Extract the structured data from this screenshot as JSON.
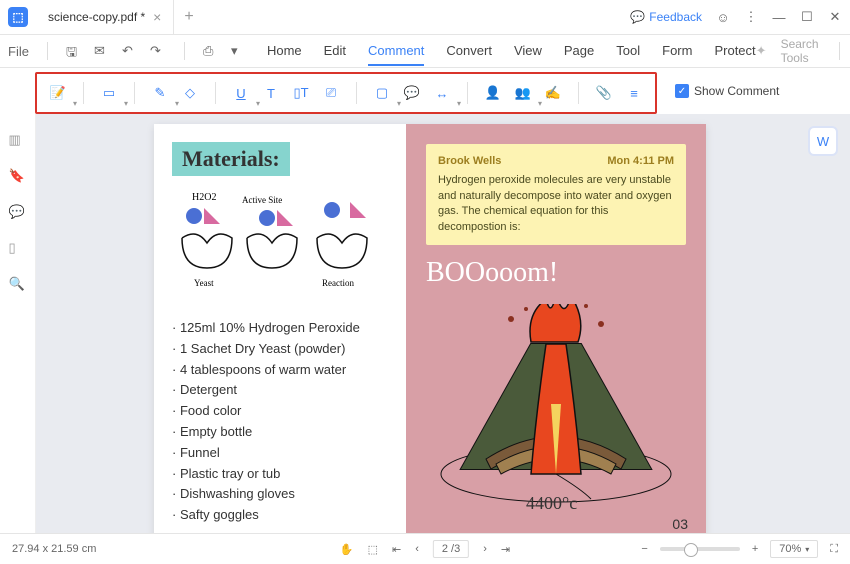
{
  "titlebar": {
    "tab_name": "science-copy.pdf *",
    "feedback": "Feedback"
  },
  "menubar": {
    "file": "File",
    "items": [
      "Home",
      "Edit",
      "Comment",
      "Convert",
      "View",
      "Page",
      "Tool",
      "Form",
      "Protect"
    ],
    "active_index": 2,
    "search_placeholder": "Search Tools"
  },
  "toolbar": {
    "show_comment": "Show Comment"
  },
  "document": {
    "materials_heading": "Materials:",
    "diagram_labels": {
      "h2o2": "H2O2",
      "active_site": "Active Site",
      "yeast": "Yeast",
      "reaction": "Reaction"
    },
    "materials": [
      "125ml 10% Hydrogen Peroxide",
      "1 Sachet Dry Yeast (powder)",
      "4 tablespoons of warm water",
      "Detergent",
      "Food color",
      "Empty bottle",
      "Funnel",
      "Plastic tray or tub",
      "Dishwashing gloves",
      "Safty goggles"
    ],
    "sticky": {
      "author": "Brook Wells",
      "time": "Mon 4:11 PM",
      "body": "Hydrogen peroxide molecules are very unstable and naturally decompose into water and oxygen gas. The chemical equation for this decompostion is:"
    },
    "boom_text": "BOOooom!",
    "temperature": "4400°c",
    "page_number": "03"
  },
  "statusbar": {
    "dimensions": "27.94 x 21.59 cm",
    "page_current": "2",
    "page_total": "3",
    "zoom": "70%"
  }
}
